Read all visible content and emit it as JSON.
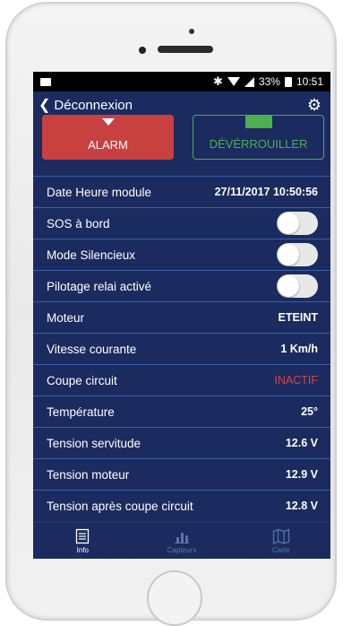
{
  "status_bar": {
    "battery": "33%",
    "time": "10:51"
  },
  "app_bar": {
    "back_label": "Déconnexion"
  },
  "buttons": {
    "alarm_label": "ALARM",
    "unlock_label": "DÉVÉRROUILLER"
  },
  "rows": [
    {
      "label": "Date Heure module",
      "value": "27/11/2017 10:50:56"
    },
    {
      "label": "SOS à bord",
      "toggle": false
    },
    {
      "label": "Mode Silencieux",
      "toggle": false
    },
    {
      "label": "Pilotage relai activé",
      "toggle": false
    },
    {
      "label": "Moteur",
      "value": "ETEINT"
    },
    {
      "label": "Vitesse courante",
      "value": "1 Km/h"
    },
    {
      "label": "Coupe circuit",
      "value": "INACTIF",
      "value_color": "#d84444"
    },
    {
      "label": "Température",
      "value": "25°"
    },
    {
      "label": "Tension servitude",
      "value": "12.6 V"
    },
    {
      "label": "Tension moteur",
      "value": "12.9 V"
    },
    {
      "label": "Tension après coupe circuit",
      "value": "12.8 V"
    }
  ],
  "tabs": [
    {
      "label": "Info",
      "icon": "document-icon",
      "active": true
    },
    {
      "label": "Capteurs",
      "icon": "bar-chart-icon",
      "active": false
    },
    {
      "label": "Carte",
      "icon": "map-icon",
      "active": false
    }
  ],
  "colors": {
    "background": "#1b2b5f",
    "alarm": "#c84040",
    "unlock": "#4caf50",
    "divider": "#3b5fa8"
  }
}
